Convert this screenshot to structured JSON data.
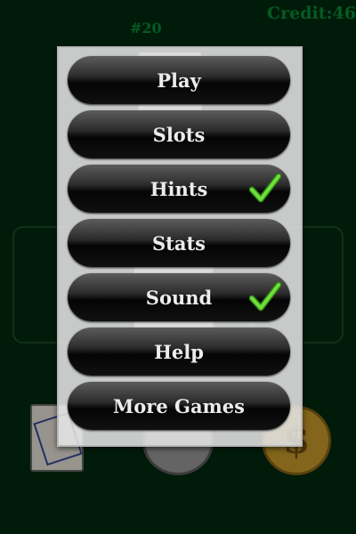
{
  "header": {
    "round_label": "#20",
    "credit_label": "Credit:46"
  },
  "menu": {
    "items": [
      {
        "label": "Play",
        "checked": false
      },
      {
        "label": "Slots",
        "checked": false
      },
      {
        "label": "Hints",
        "checked": true
      },
      {
        "label": "Stats",
        "checked": false
      },
      {
        "label": "Sound",
        "checked": true
      },
      {
        "label": "Help",
        "checked": false
      },
      {
        "label": "More Games",
        "checked": false
      }
    ]
  },
  "table": {
    "gold_coin_symbol": "$",
    "check_icon": "checkmark-icon"
  },
  "colors": {
    "felt": "#012a10",
    "score_text": "#0c8a35",
    "button_text": "#ececec",
    "check_green": "#4cd22c"
  }
}
